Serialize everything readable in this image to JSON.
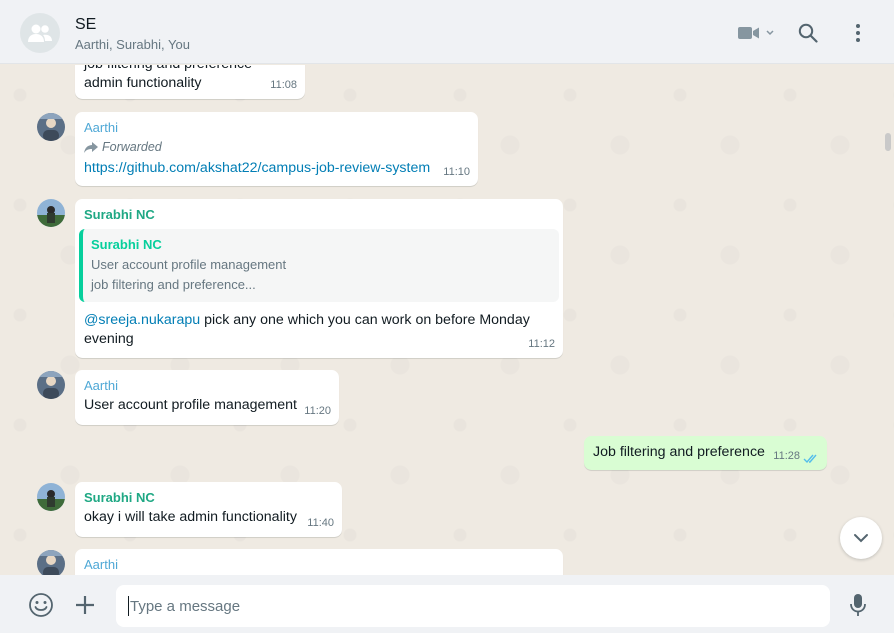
{
  "header": {
    "title": "SE",
    "subtitle": "Aarthi, Surabhi, You",
    "icons": [
      "group-avatar-icon",
      "video-call-icon",
      "chevron-down-icon",
      "search-icon",
      "menu-icon"
    ]
  },
  "messages": {
    "m0": {
      "line1": "job filtering and preference",
      "line2": "admin functionality",
      "time": "11:08"
    },
    "m1": {
      "sender": "Aarthi",
      "forwarded": "Forwarded",
      "text": "https://github.com/akshat22/campus-job-review-system",
      "time": "11:10"
    },
    "m2": {
      "sender": "Surabhi NC",
      "quote_name": "Surabhi NC",
      "quote_line1": "User account profile management",
      "quote_line2": "job filtering and preference...",
      "mention": "@sreeja.nukarapu",
      "text": " pick any one which you can work on before Monday",
      "text2": "evening",
      "time": "11:12"
    },
    "m3": {
      "sender": "Aarthi",
      "text": "User account profile management",
      "time": "11:20"
    },
    "m4": {
      "text": "Job filtering and preference",
      "time": "11:28"
    },
    "m5": {
      "sender": "Surabhi NC",
      "text": "okay i will take admin functionality",
      "time": "11:40"
    },
    "m6": {
      "sender": "Aarthi"
    }
  },
  "footer": {
    "placeholder": "Type a message",
    "icons": [
      "emoji-icon",
      "attach-plus-icon",
      "microphone-icon"
    ]
  },
  "colors": {
    "chat_bg": "#efeae2",
    "outgoing_bubble": "#d9fdd3",
    "incoming_bubble": "#ffffff",
    "read_ticks": "#53bdeb",
    "link": "#027eb5",
    "surabhi_name": "#06cf9c",
    "aarthi_name": "#53bdeb"
  }
}
